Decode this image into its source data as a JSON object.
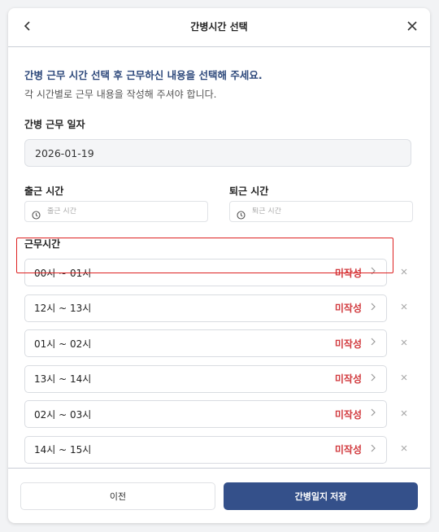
{
  "header": {
    "title": "간병시간 선택",
    "back_icon": "chevron-left-icon",
    "close_icon": "close-icon"
  },
  "intro": {
    "primary": "간병 근무 시간 선택 후 근무하신 내용을 선택해 주세요.",
    "secondary": "각 시간별로 근무 내용을 작성해 주셔야 합니다."
  },
  "work_date": {
    "label": "간병 근무 일자",
    "value": "2026-01-19"
  },
  "clock_in": {
    "label": "출근 시간",
    "placeholder": "출근 시간"
  },
  "clock_out": {
    "label": "퇴근 시간",
    "placeholder": "퇴근 시간"
  },
  "work_hours": {
    "label": "근무시간",
    "slots": [
      {
        "range": "00시 ~ 01시",
        "status": "미작성"
      },
      {
        "range": "12시 ~ 13시",
        "status": "미작성"
      },
      {
        "range": "01시 ~ 02시",
        "status": "미작성"
      },
      {
        "range": "13시 ~ 14시",
        "status": "미작성"
      },
      {
        "range": "02시 ~ 03시",
        "status": "미작성"
      },
      {
        "range": "14시 ~ 15시",
        "status": "미작성"
      }
    ]
  },
  "footer": {
    "prev_label": "이전",
    "save_label": "간병일지 저장"
  },
  "colors": {
    "accent": "#34508a",
    "status": "#d1393d",
    "intro": "#2f4a7c"
  }
}
